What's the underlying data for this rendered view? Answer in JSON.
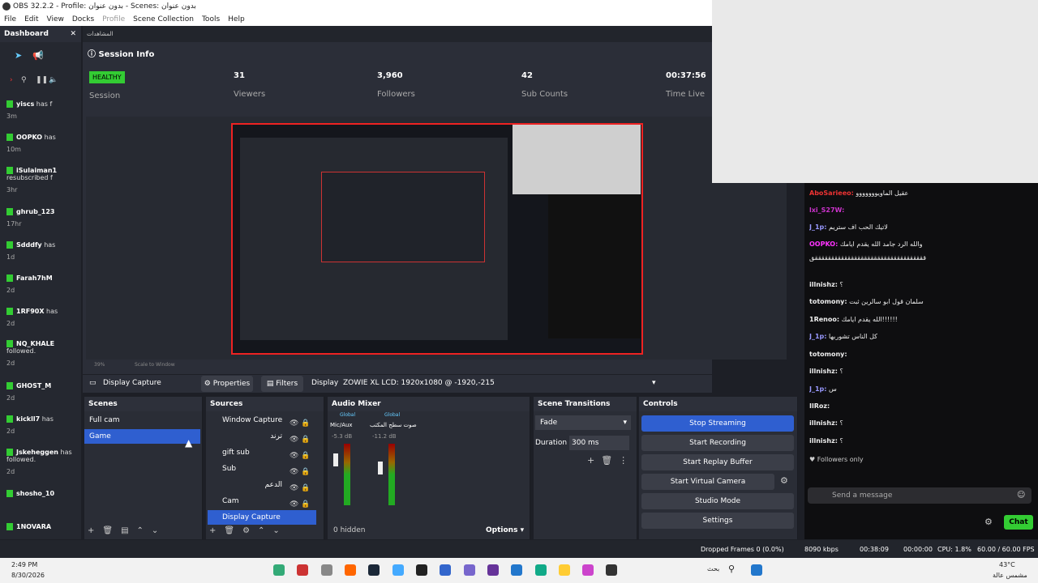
{
  "window": {
    "title": "OBS 32.2.2 - Profile: بدون عنوان - Scenes: بدون عنوان"
  },
  "menu": [
    "File",
    "Edit",
    "View",
    "Docks",
    "Profile",
    "Scene Collection",
    "Tools",
    "Help"
  ],
  "dashboard": {
    "title": "Dashboard",
    "tab": "المشاهدات"
  },
  "activity": [
    {
      "user": "yiscs",
      "text": "has f",
      "time": "3m"
    },
    {
      "user": "OOPKO",
      "text": "has",
      "time": "10m"
    },
    {
      "user": "iSulaiman1",
      "text": "resubscribed f",
      "time": "3hr"
    },
    {
      "user": "ghrub_123",
      "text": "",
      "time": "17hr"
    },
    {
      "user": "Sdddfy",
      "text": "has",
      "time": "1d"
    },
    {
      "user": "Farah7hM",
      "text": "",
      "time": "2d"
    },
    {
      "user": "1RF90X",
      "text": "has",
      "time": "2d"
    },
    {
      "user": "NQ_KHALE",
      "text": "followed.",
      "time": "2d"
    },
    {
      "user": "GHOST_M",
      "text": "",
      "time": "2d"
    },
    {
      "user": "kickll7",
      "text": "has",
      "time": "2d"
    },
    {
      "user": "Jskeheggen",
      "text": "has followed.",
      "time": "2d"
    },
    {
      "user": "shosho_10",
      "text": "",
      "time": ""
    },
    {
      "user": "1NOVARA",
      "text": "",
      "time": ""
    }
  ],
  "session": {
    "title": "Session Info",
    "health": "HEALTHY",
    "health_label": "Session",
    "viewers": "31",
    "viewers_label": "Viewers",
    "followers": "3,960",
    "followers_label": "Followers",
    "subs": "42",
    "subs_label": "Sub Counts",
    "time": "00:37:56",
    "time_label": "Time Live"
  },
  "zoom": {
    "value": "39%",
    "mode": "Scale to Window"
  },
  "source_toolbar": {
    "source": "Display Capture",
    "properties": "Properties",
    "filters": "Filters",
    "display_label": "Display",
    "display_value": "ZOWIE XL LCD: 1920x1080 @ -1920,-215"
  },
  "scenes": {
    "title": "Scenes",
    "items": [
      "Full cam",
      "Game"
    ]
  },
  "sources": {
    "title": "Sources",
    "items": [
      "Window Capture",
      "ترند",
      "gift sub",
      "Sub",
      "الدعم",
      "Cam",
      "Display Capture"
    ]
  },
  "mixer": {
    "title": "Audio Mixer",
    "ch1": "Mic/Aux",
    "ch2": "صوت سطح المكتب",
    "global": "Global",
    "db1": "-5.3 dB",
    "db2": "-11.2 dB",
    "hidden": "0 hidden",
    "options": "Options"
  },
  "transitions": {
    "title": "Scene Transitions",
    "type": "Fade",
    "duration_label": "Duration",
    "duration": "300 ms"
  },
  "controls": {
    "title": "Controls",
    "buttons": [
      "Stop Streaming",
      "Start Recording",
      "Start Replay Buffer",
      "Start Virtual Camera",
      "Studio Mode",
      "Settings"
    ]
  },
  "status": {
    "dropped": "Dropped Frames 0 (0.0%)",
    "kbps": "8090 kbps",
    "stream_time": "00:38:09",
    "rec_time": "00:00:00",
    "cpu": "CPU: 1.8%",
    "fps": "60.00 / 60.00 FPS"
  },
  "chat": {
    "messages": [
      {
        "user": "AboSarieeo:",
        "text": "عقيل الماويووووووو",
        "color": "#e33"
      },
      {
        "user": "lxi_S27W:",
        "text": "",
        "color": "#c3c"
      },
      {
        "user": "J_1p:",
        "text": "لاتيك الحب اف ستريم",
        "color": "#99f"
      },
      {
        "user": "OOPKO:",
        "text": "والله الرد جامد الله يقدم ايامك",
        "color": "#f3f"
      },
      {
        "user": "",
        "text": "ققققققققققققققققققققققققققققققققققق",
        "color": "#fff"
      },
      {
        "user": "illnishz:",
        "text": "؟",
        "color": "#fff"
      },
      {
        "user": "totomony:",
        "text": "سلمان قول ابو سالرين ثبت",
        "color": "#fff"
      },
      {
        "user": "1Renoo:",
        "text": "الله يقدم ايامك!!!!!!",
        "color": "#fff"
      },
      {
        "user": "J_1p:",
        "text": "كل الناس تشوربها",
        "color": "#99f"
      },
      {
        "user": "totomony:",
        "text": "",
        "color": "#fff"
      },
      {
        "user": "illnishz:",
        "text": "؟",
        "color": "#fff"
      },
      {
        "user": "J_1p:",
        "text": "س",
        "color": "#99f"
      },
      {
        "user": "IlRoz:",
        "text": "",
        "color": "#fff"
      },
      {
        "user": "illnishz:",
        "text": "؟",
        "color": "#fff"
      },
      {
        "user": "illnishz:",
        "text": "؟",
        "color": "#fff"
      }
    ],
    "followers_only": "Followers only",
    "placeholder": "Send a message",
    "send": "Chat"
  },
  "taskbar": {
    "time": "2:49 PM",
    "date": "8/30/2026",
    "search": "بحث",
    "temp": "43°C",
    "weather": "مشمس عالة"
  }
}
